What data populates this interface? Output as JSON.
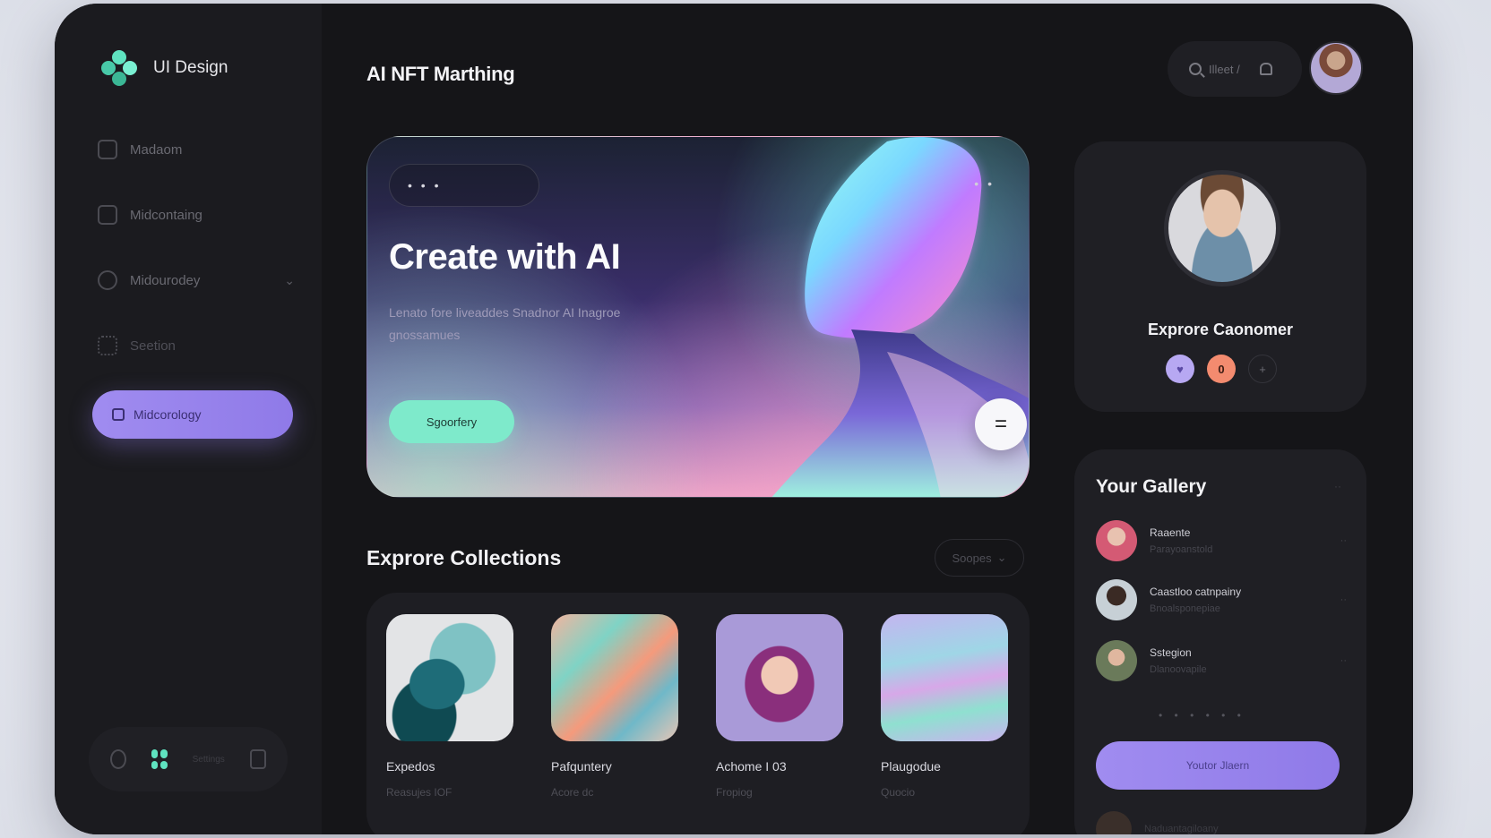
{
  "brand": {
    "name": "UI Design"
  },
  "page": {
    "title": "AI NFT Marthing"
  },
  "sidebar": {
    "items": [
      {
        "label": "Madaom",
        "icon": "calendar-icon"
      },
      {
        "label": "Midcontaing",
        "icon": "bag-icon"
      },
      {
        "label": "Midourodey",
        "icon": "gear-icon",
        "has_chevron": true
      },
      {
        "label": "Seetion",
        "icon": "users-icon"
      }
    ],
    "active": {
      "label": "Midcorology",
      "icon": "lock-icon"
    },
    "footer": {
      "label": "Settings"
    }
  },
  "topbar": {
    "search_placeholder": "Illeet /",
    "search_icon": "search-icon",
    "bell_icon": "bell-icon"
  },
  "hero": {
    "title": "Create with AI",
    "description": "Lenato fore liveaddes Snadnor AI Inagroe gnossamues",
    "button": "Sgoorfery",
    "fab_icon": "menu-icon",
    "dots": "• • •",
    "more": "• •"
  },
  "collections": {
    "title": "Exprore Collections",
    "filter": "Soopes",
    "items": [
      {
        "title": "Expedos",
        "sub": "Reasujes IOF"
      },
      {
        "title": "Pafquntery",
        "sub": "Acore dc"
      },
      {
        "title": "Achome I 03",
        "sub": "Fropiog"
      },
      {
        "title": "Plaugodue",
        "sub": "Quocio"
      }
    ]
  },
  "profile": {
    "name": "Exprore Caonomer",
    "badge_1": "♥",
    "badge_2": "0",
    "badge_3": "+"
  },
  "gallery": {
    "title": "Your Gallery",
    "items": [
      {
        "name": "Raaente",
        "sub": "Parayoanstold"
      },
      {
        "name": "Caastloo catnpainy",
        "sub": "Bnoalsponepiae"
      },
      {
        "name": "Sstegion",
        "sub": "Dlanoovapile"
      }
    ],
    "dots": "• • • • • •",
    "button": "Youtor Jlaern",
    "peek": "Naduantagiloany"
  },
  "colors": {
    "accent_purple": "#9b86ee",
    "accent_mint": "#7eeacb",
    "accent_orange": "#f38b6f",
    "bg": "#151518"
  }
}
